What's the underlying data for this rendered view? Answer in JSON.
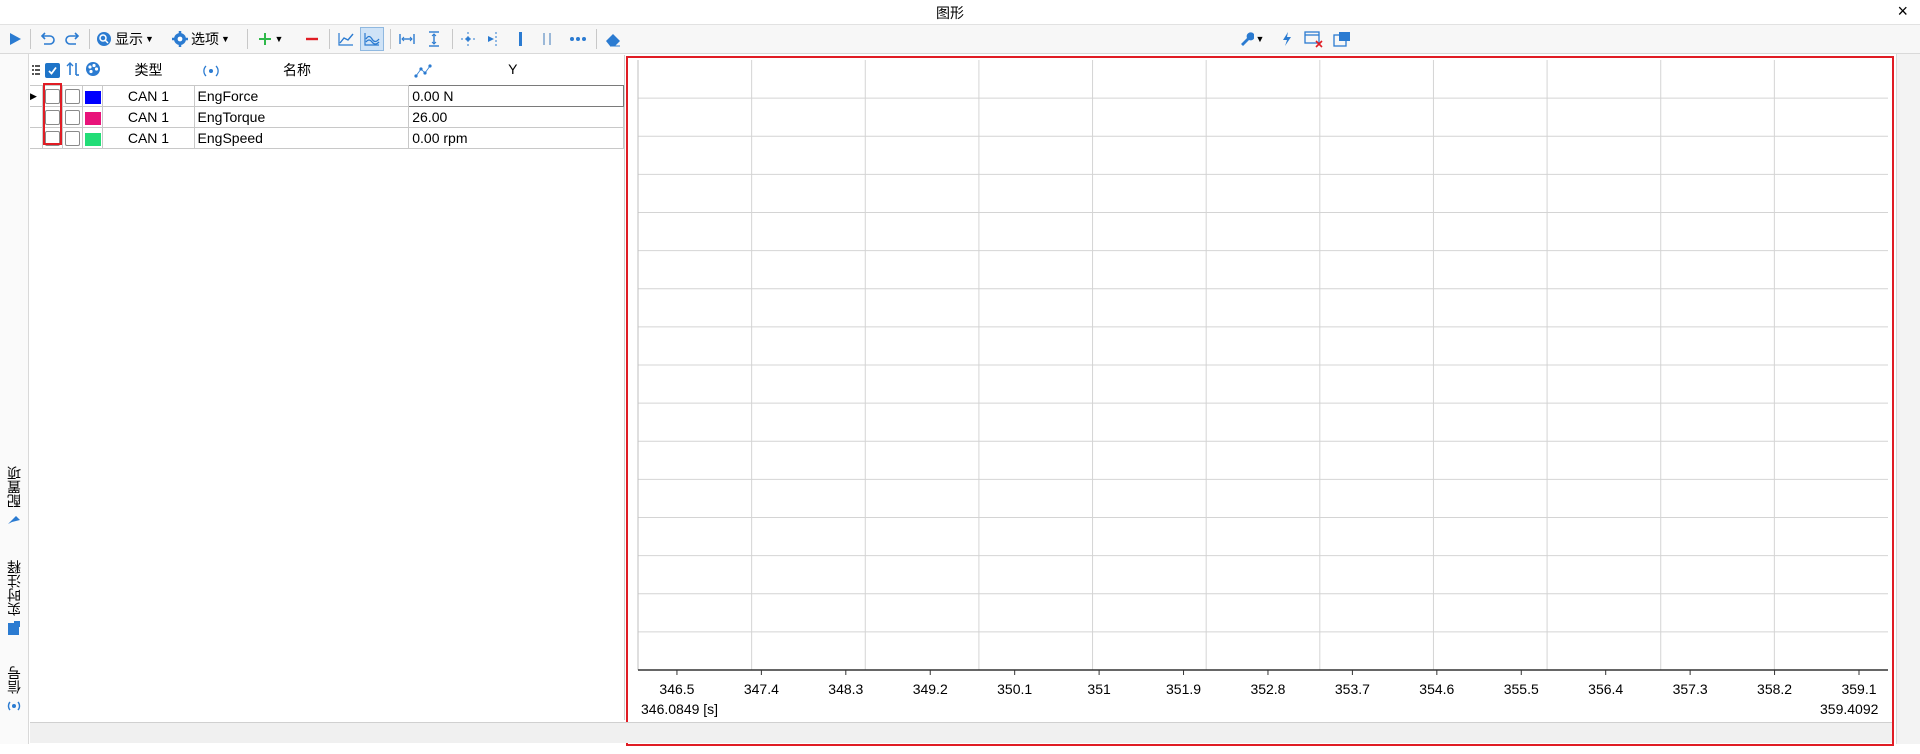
{
  "window": {
    "title": "图形",
    "close_label": "×"
  },
  "toolbar": {
    "display_label": "显示",
    "options_label": "选项",
    "icons": [
      "play-icon",
      "undo-icon",
      "redo-icon",
      "search-icon",
      "gear-icon",
      "add-icon",
      "remove-icon",
      "line-chart-icon",
      "wave-icon",
      "fit-width-icon",
      "fit-height-icon",
      "zoom-point-icon",
      "cursor-icon",
      "single-bar-icon",
      "double-bar-icon",
      "more-icon",
      "eraser-icon",
      "wrench-icon",
      "lightning-icon",
      "window-close-icon",
      "export-icon"
    ]
  },
  "left_tabs": [
    {
      "label": "配置项",
      "icon": "pin-icon"
    },
    {
      "label": "实时注释",
      "icon": "note-icon"
    },
    {
      "label": "信号",
      "icon": "signal-icon"
    }
  ],
  "table": {
    "headers": {
      "type": "类型",
      "name": "名称",
      "y": "Y"
    },
    "rows": [
      {
        "type": "CAN 1",
        "name": "EngForce",
        "value": "0.00 N",
        "color": "#0000ff"
      },
      {
        "type": "CAN 1",
        "name": "EngTorque",
        "value": "26.00",
        "color": "#e8137a"
      },
      {
        "type": "CAN 1",
        "name": "EngSpeed",
        "value": "0.00 rpm",
        "color": "#22dd77"
      }
    ]
  },
  "plot": {
    "x_ticks": [
      "346.5",
      "347.4",
      "348.3",
      "349.2",
      "350.1",
      "351",
      "351.9",
      "352.8",
      "353.7",
      "354.6",
      "355.5",
      "356.4",
      "357.3",
      "358.2",
      "359.1"
    ],
    "time_start": "346.0849 [s]",
    "time_end": "359.4092",
    "x_range": [
      346.0849,
      359.4092
    ],
    "grid": true
  },
  "colors": {
    "accent": "#1e74c8",
    "highlight": "#e01c24"
  }
}
